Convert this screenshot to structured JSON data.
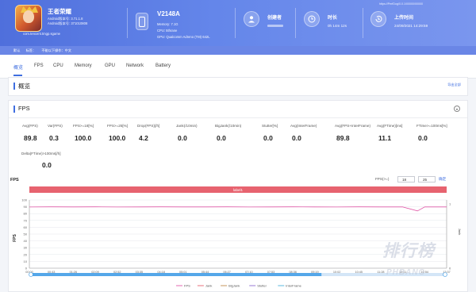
{
  "app": {
    "name": "王者荣耀",
    "android_version": "Android版本号: 3.71.1.8",
    "android_code": "Android版本号: 371010808",
    "package": "com.tencent.tmgp.sgame"
  },
  "device": {
    "name": "V2148A",
    "memory": "Memory: 7.1G",
    "cpu": "CPU: 5thrane",
    "gpu": "GPU: Qualcomm Adreno (TM) 642L"
  },
  "stats": {
    "creator_title": "创建者",
    "duration_title": "时长",
    "duration_value": "0h 14m 12s",
    "upload_title": "上传时间",
    "upload_value": "24/09/2021 14:29:59",
    "top_url": "https://PerfDog/0.0.1/00000/00000"
  },
  "subbar": [
    "默认",
    "标签：",
    "不能以下操作：中文"
  ],
  "tabs": [
    "概览",
    "FPS",
    "CPU",
    "Memory",
    "GPU",
    "Network",
    "Battery"
  ],
  "overview": {
    "title": "概览",
    "export": "导出全部"
  },
  "fps_section": {
    "title": "FPS",
    "collapse_icon": "chevron-up-icon",
    "metrics": [
      {
        "label": "Avg(FPS)",
        "value": "89.8"
      },
      {
        "label": "Var(FPS)",
        "value": "0.3"
      },
      {
        "label": "FPS>=18[%]",
        "value": "100.0"
      },
      {
        "label": "FPS>=25[%]",
        "value": "100.0"
      },
      {
        "label": "Drop(FPS)[/h]",
        "value": "4.2"
      },
      {
        "label": "Jank(/10min)",
        "value": "0.0"
      },
      {
        "label": "BigJank(/10min)",
        "value": "0.0"
      },
      {
        "label": "Stutter[%]",
        "value": "0.0"
      },
      {
        "label": "Avg(InterFrame)",
        "value": "0.0"
      },
      {
        "label": "Avg(FPS+InterFrame)",
        "value": "89.8"
      },
      {
        "label": "Avg(FTime)[ms]",
        "value": "11.1"
      },
      {
        "label": "FTime>=100ms[%]",
        "value": "0.0"
      }
    ],
    "metric2": {
      "label": "Delta(FTime)>100ms[/h]",
      "value": "0.0"
    }
  },
  "chart_header": {
    "label": "FPS",
    "filter_label": "FPS(>=)",
    "filter_min": "18",
    "filter_max": "25",
    "confirm": "确定"
  },
  "colors": {
    "header_start": "#4f6fdc",
    "accent": "#3f6ee0",
    "fps_line": "#e05aa8",
    "label_bar": "#e7636f"
  },
  "watermark": {
    "main": "排行榜",
    "sub": "PHBANG"
  },
  "chart_data": {
    "type": "line",
    "title": "label1",
    "ylabel": "FPS",
    "xlabel": "",
    "ylim": [
      0,
      100
    ],
    "yticks": [
      0,
      10,
      20,
      30,
      40,
      50,
      60,
      70,
      80,
      90,
      100
    ],
    "right_axis_label": "Jank",
    "right_ylim": [
      0,
      1
    ],
    "xticks": [
      "00:00",
      "00:43",
      "01:26",
      "02:09",
      "02:52",
      "03:35",
      "04:18",
      "05:01",
      "05:44",
      "06:27",
      "07:10",
      "07:53",
      "08:36",
      "09:19",
      "10:02",
      "10:45",
      "11:28",
      "12:11",
      "12:54",
      "13:37"
    ],
    "grid": true,
    "legend_position": "bottom",
    "series": [
      {
        "name": "FPS",
        "color": "#e05aa8",
        "x": [
          0,
          43,
          86,
          129,
          172,
          215,
          258,
          301,
          344,
          387,
          430,
          473,
          516,
          559,
          602,
          645,
          688,
          731,
          760,
          774,
          817
        ],
        "values": [
          89.7,
          89.9,
          89.8,
          89.9,
          89.7,
          89.8,
          89.9,
          89.8,
          89.8,
          89.9,
          89.7,
          89.8,
          89.9,
          89.8,
          89.7,
          89.9,
          89.8,
          89.8,
          84,
          89.8,
          89.8
        ]
      },
      {
        "name": "Jank",
        "color": "#e7636f",
        "values": []
      },
      {
        "name": "BigJank",
        "color": "#c08a4c",
        "values": []
      },
      {
        "name": "Stutter",
        "color": "#8e6bd1",
        "values": []
      },
      {
        "name": "InterFrame",
        "color": "#4cb1d8",
        "values": []
      }
    ]
  }
}
